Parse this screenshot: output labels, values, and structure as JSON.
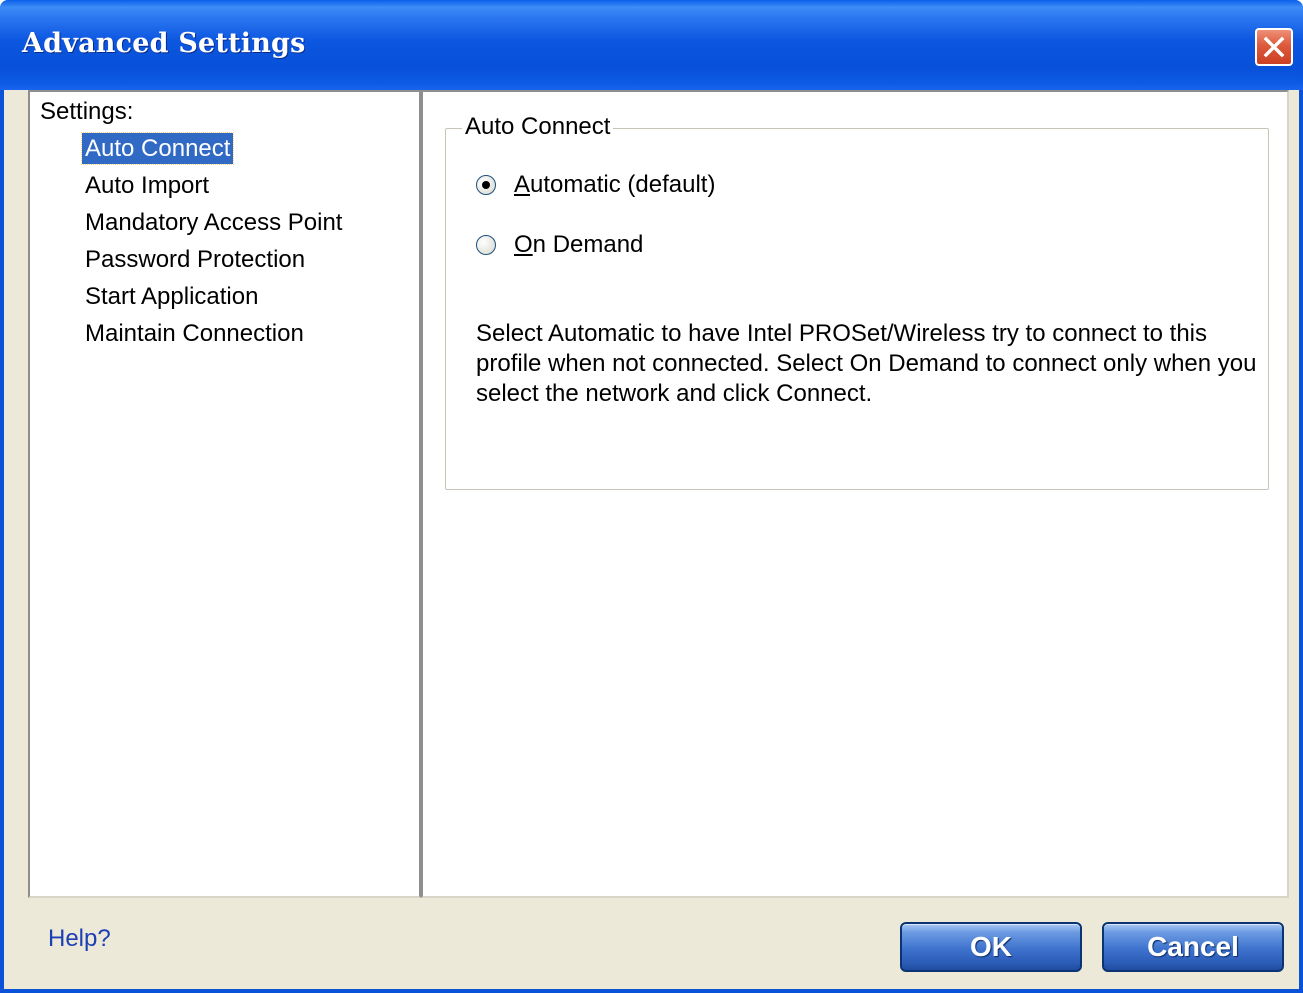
{
  "window": {
    "title": "Advanced Settings"
  },
  "settings_list": {
    "header": "Settings:",
    "items": [
      {
        "label": "Auto Connect",
        "selected": true
      },
      {
        "label": "Auto Import",
        "selected": false
      },
      {
        "label": "Mandatory Access Point",
        "selected": false
      },
      {
        "label": "Password Protection",
        "selected": false
      },
      {
        "label": "Start Application",
        "selected": false
      },
      {
        "label": "Maintain Connection",
        "selected": false
      }
    ]
  },
  "auto_connect": {
    "group_title": "Auto Connect",
    "options": [
      {
        "accel": "A",
        "rest": "utomatic (default)",
        "checked": true
      },
      {
        "accel": "O",
        "rest": "n Demand",
        "checked": false
      }
    ],
    "description": "Select Automatic to have Intel PROSet/Wireless try to connect to this profile when not connected. Select On Demand to connect only when you select the network and click Connect."
  },
  "footer": {
    "help_label": "Help?",
    "ok_label": "OK",
    "cancel_label": "Cancel"
  },
  "colors": {
    "titlebar": "#0c57e0",
    "selection": "#316ac5",
    "dialog_bg": "#ece9d8",
    "help_link": "#1d3fb5"
  },
  "icons": {
    "close": "close-icon"
  }
}
